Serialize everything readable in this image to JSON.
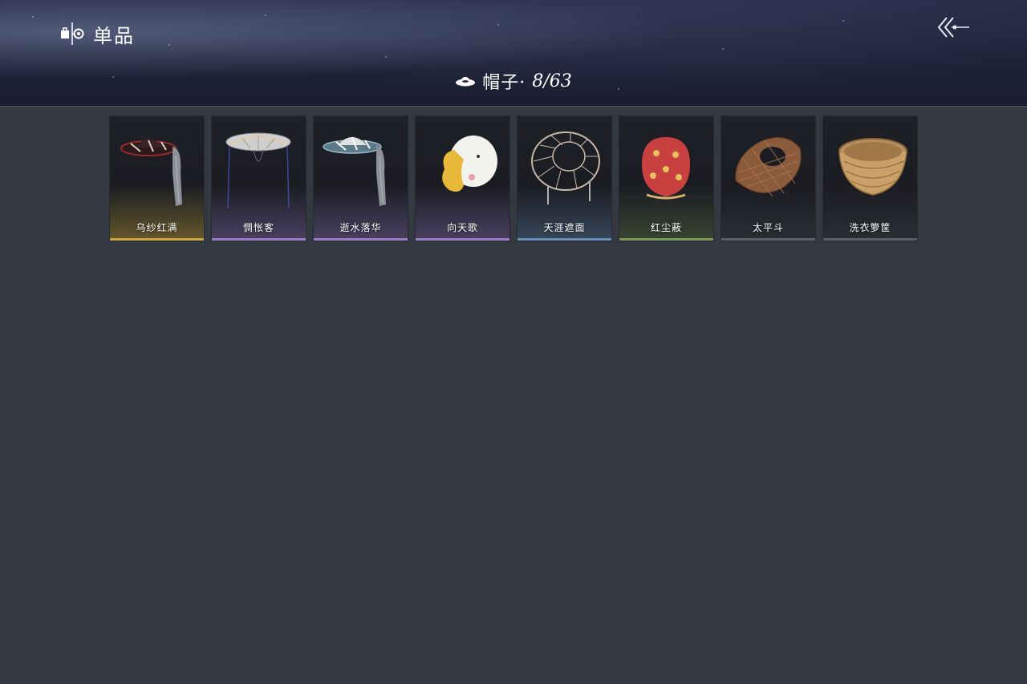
{
  "header": {
    "title": "单品",
    "title_icon": "collection-icon",
    "back_icon": "back-arrow-icon"
  },
  "category": {
    "icon": "hat-icon",
    "label": "帽子·",
    "count": "8/63"
  },
  "items": [
    {
      "name": "乌纱红满",
      "icon": "veiled-hat-icon",
      "rarity_color": "#c9a640"
    },
    {
      "name": "惆怅客",
      "icon": "conical-hat-icon",
      "rarity_color": "#9a7fc8"
    },
    {
      "name": "逝水落华",
      "icon": "veiled-hat-icon",
      "rarity_color": "#9a7fc8"
    },
    {
      "name": "向天歌",
      "icon": "goose-hat-icon",
      "rarity_color": "#9a7fc8"
    },
    {
      "name": "天涯遮面",
      "icon": "frame-hat-icon",
      "rarity_color": "#6a8fb8"
    },
    {
      "name": "红尘蔽",
      "icon": "red-hood-icon",
      "rarity_color": "#7a9a5a"
    },
    {
      "name": "太平斗",
      "icon": "woven-hat-icon",
      "rarity_color": "#5a6068"
    },
    {
      "name": "洗衣箩筐",
      "icon": "basket-hat-icon",
      "rarity_color": "#5a6068"
    }
  ]
}
